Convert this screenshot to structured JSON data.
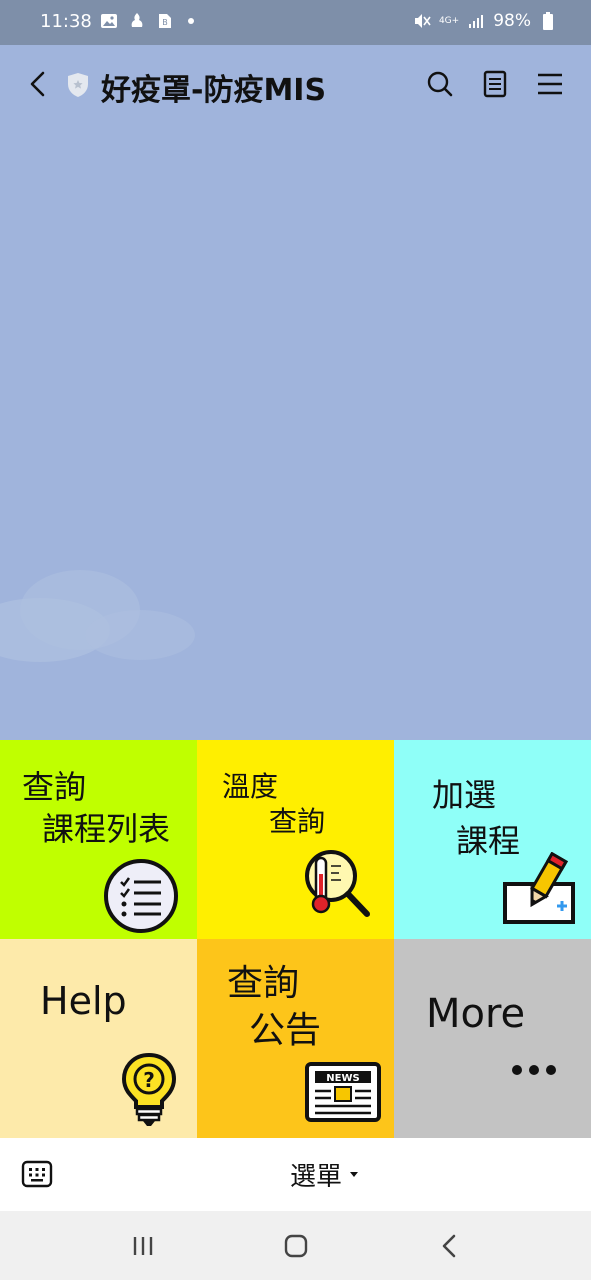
{
  "status_bar": {
    "time": "11:38",
    "network": "4G+",
    "battery": "98%",
    "left_icons": [
      "image-icon",
      "notification-icon",
      "app-icon"
    ],
    "right_icons": [
      "mute-icon",
      "signal-icon",
      "battery-icon"
    ]
  },
  "header": {
    "title": "好疫罩-防疫MIS",
    "icons": [
      "back-icon",
      "shield-icon",
      "search-icon",
      "notes-icon",
      "menu-icon"
    ]
  },
  "rich_menu": {
    "tiles": [
      {
        "id": "course-list",
        "lines": [
          "查詢",
          "課程列表"
        ],
        "color": "#c0ff00",
        "icon": "checklist-icon"
      },
      {
        "id": "temperature",
        "lines": [
          "溫度",
          "查詢"
        ],
        "color": "#ffef00",
        "icon": "thermometer-search-icon"
      },
      {
        "id": "add-course",
        "lines": [
          "加選",
          "課程"
        ],
        "color": "#8ffff8",
        "icon": "pencil-add-icon"
      },
      {
        "id": "help",
        "lines": [
          "Help"
        ],
        "color": "#fdeaaa",
        "icon": "lightbulb-question-icon"
      },
      {
        "id": "announcements",
        "lines": [
          "查詢",
          "公告"
        ],
        "color": "#fdc51a",
        "icon": "news-icon"
      },
      {
        "id": "more",
        "lines": [
          "More"
        ],
        "color": "#c3c3c3",
        "icon": "ellipsis-icon"
      }
    ],
    "news_badge": "NEWS"
  },
  "bottom_bar": {
    "menu_label": "選單",
    "keyboard_icon": "keyboard-icon"
  },
  "nav_bar": {
    "buttons": [
      "recent-apps-icon",
      "home-icon",
      "back-nav-icon"
    ]
  }
}
